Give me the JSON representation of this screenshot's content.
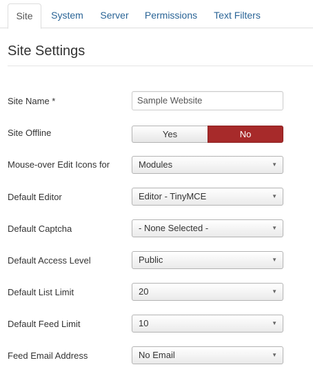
{
  "tabs": [
    {
      "label": "Site",
      "active": true
    },
    {
      "label": "System",
      "active": false
    },
    {
      "label": "Server",
      "active": false
    },
    {
      "label": "Permissions",
      "active": false
    },
    {
      "label": "Text Filters",
      "active": false
    }
  ],
  "page": {
    "title": "Site Settings"
  },
  "fields": {
    "site_name": {
      "label": "Site Name *",
      "value": "Sample Website"
    },
    "site_offline": {
      "label": "Site Offline",
      "yes_label": "Yes",
      "no_label": "No",
      "selected": "No"
    },
    "mouseover_edit_icons": {
      "label": "Mouse-over Edit Icons for",
      "value": "Modules"
    },
    "default_editor": {
      "label": "Default Editor",
      "value": "Editor - TinyMCE"
    },
    "default_captcha": {
      "label": "Default Captcha",
      "value": "- None Selected -"
    },
    "default_access_level": {
      "label": "Default Access Level",
      "value": "Public"
    },
    "default_list_limit": {
      "label": "Default List Limit",
      "value": "20"
    },
    "default_feed_limit": {
      "label": "Default Feed Limit",
      "value": "10"
    },
    "feed_email_address": {
      "label": "Feed Email Address",
      "value": "No Email"
    }
  },
  "colors": {
    "accent_red": "#a72a2a",
    "link_blue": "#2a6496"
  },
  "icons": {
    "select_arrow": "chevron-down-icon"
  }
}
